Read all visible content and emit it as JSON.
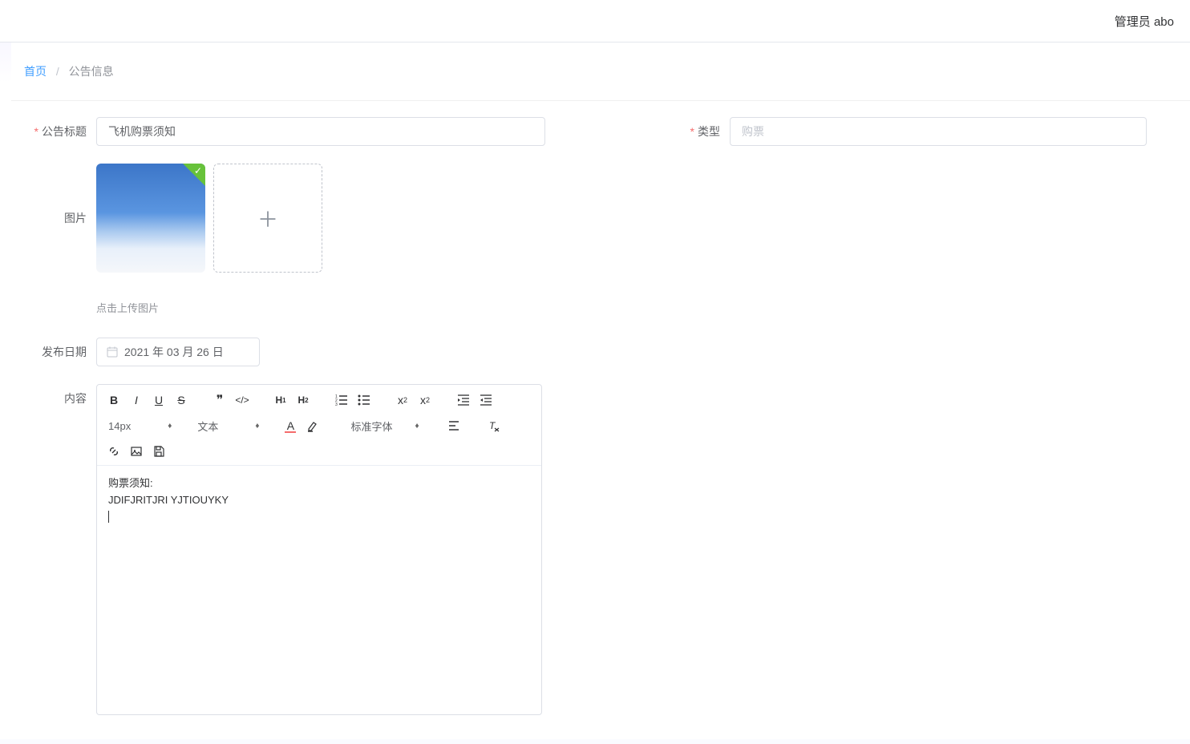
{
  "header": {
    "user_label": "管理员 abo"
  },
  "breadcrumb": {
    "home": "首页",
    "current": "公告信息"
  },
  "form": {
    "title_label": "公告标题",
    "title_value": "飞机购票须知",
    "type_label": "类型",
    "type_value": "购票",
    "image_label": "图片",
    "image_hint": "点击上传图片",
    "date_label": "发布日期",
    "date_value": "2021 年 03 月 26 日",
    "content_label": "内容"
  },
  "editor": {
    "fontsize": "14px",
    "paragraph": "文本",
    "fontfamily": "标准字体",
    "body_line1": "购票须知:",
    "body_line2": "JDIFJRITJRI  YJTIOUYKY"
  }
}
